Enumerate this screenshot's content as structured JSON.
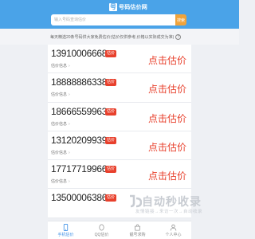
{
  "header": {
    "logo_mark": "号",
    "logo_text": "号码估价网",
    "search_placeholder": "输入号码查询估价",
    "search_button": "搜索",
    "accent": "#4aa3e8"
  },
  "notice": {
    "text": "每天精选20条号码供大家免费估价(估价仅供参考,价格以实际成交为准)"
  },
  "items": [
    {
      "number": "13910006668",
      "tag": "估价",
      "sub": "估价信息",
      "cta": "点击估价"
    },
    {
      "number": "18888886338",
      "tag": "估价",
      "sub": "估价信息",
      "cta": "点击估价"
    },
    {
      "number": "18666559963",
      "tag": "估价",
      "sub": "估价信息",
      "cta": "点击估价"
    },
    {
      "number": "13120209939",
      "tag": "估价",
      "sub": "估价信息",
      "cta": "点击估价"
    },
    {
      "number": "17717719966",
      "tag": "估价",
      "sub": "估价信息",
      "cta": "点击估价"
    },
    {
      "number": "13500006386",
      "tag": "估价",
      "sub": "",
      "cta": ""
    }
  ],
  "tabs": [
    {
      "label": "手机估价",
      "icon": "phone-icon",
      "active": true
    },
    {
      "label": "QQ估价",
      "icon": "qq-icon",
      "active": false
    },
    {
      "label": "靓号求购",
      "icon": "shop-icon",
      "active": false
    },
    {
      "label": "个人中心",
      "icon": "user-icon",
      "active": false
    }
  ],
  "watermark": {
    "title": "自动秒收录",
    "subtitle": "友情链接→来访一次→自动收录"
  },
  "colors": {
    "red": "#e8402c",
    "tab_active": "#3a8ee6"
  }
}
